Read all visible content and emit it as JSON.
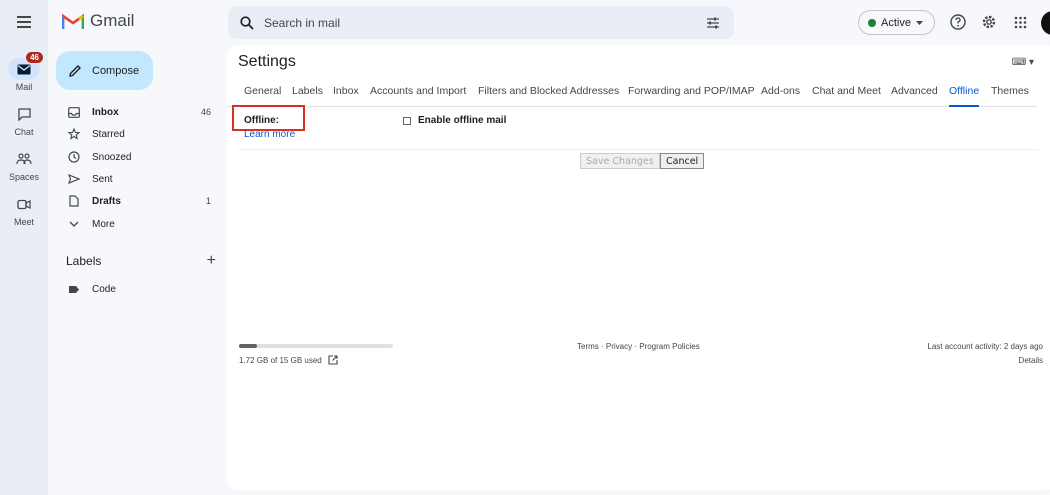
{
  "app": {
    "logo_text": "Gmail"
  },
  "rail": {
    "items": [
      {
        "label": "Mail",
        "badge": "46"
      },
      {
        "label": "Chat"
      },
      {
        "label": "Spaces"
      },
      {
        "label": "Meet"
      }
    ]
  },
  "sidebar": {
    "compose_label": "Compose",
    "items": [
      {
        "label": "Inbox",
        "count": "46"
      },
      {
        "label": "Starred",
        "count": ""
      },
      {
        "label": "Snoozed",
        "count": ""
      },
      {
        "label": "Sent",
        "count": ""
      },
      {
        "label": "Drafts",
        "count": "1"
      },
      {
        "label": "More",
        "count": ""
      }
    ],
    "labels_header": "Labels",
    "labels": [
      {
        "label": "Code"
      }
    ]
  },
  "search": {
    "placeholder": "Search in mail"
  },
  "status": {
    "label": "Active",
    "color": "#188038"
  },
  "settings": {
    "title": "Settings",
    "tabs": [
      "General",
      "Labels",
      "Inbox",
      "Accounts and Import",
      "Filters and Blocked Addresses",
      "Forwarding and POP/IMAP",
      "Add-ons",
      "Chat and Meet",
      "Advanced",
      "Offline",
      "Themes"
    ],
    "active_tab": "Offline",
    "offline_label": "Offline:",
    "learn_more": "Learn more",
    "enable_offline": "Enable offline mail",
    "save_button": "Save Changes",
    "cancel_button": "Cancel"
  },
  "footer": {
    "storage_text": "1.72 GB of 15 GB used",
    "storage_fraction": 0.115,
    "links": [
      "Terms",
      "Privacy",
      "Program Policies"
    ],
    "activity": "Last account activity: 2 days ago",
    "details": "Details"
  },
  "colors": {
    "accent": "#0b57d0",
    "compose_bg": "#c2e7ff",
    "highlight_border": "#d93025",
    "badge": "#b3261e"
  }
}
